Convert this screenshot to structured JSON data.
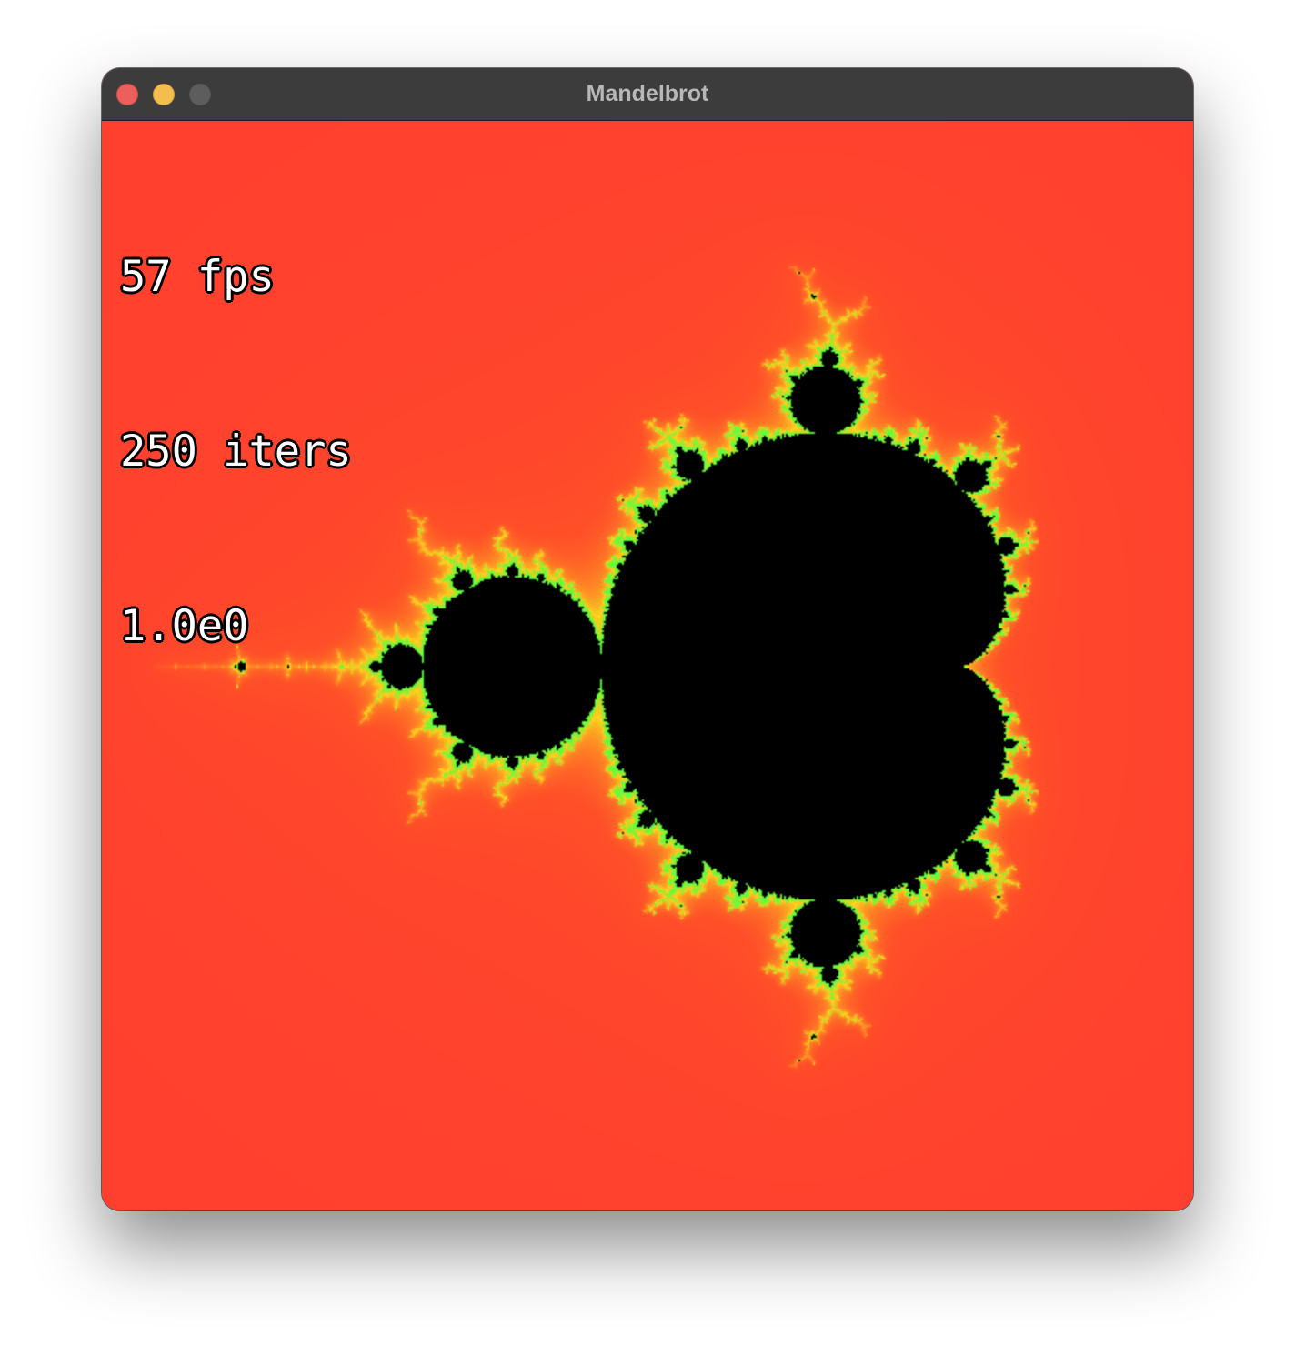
{
  "window": {
    "title": "Mandelbrot"
  },
  "overlay": {
    "fps": "57 fps",
    "iterations": "250 iters",
    "zoom": "1.0e0"
  },
  "colors": {
    "background": "#ff3b30",
    "set_interior": "#000000",
    "edge_glow": "#ffb020",
    "edge_detail": "#5cff3a",
    "titlebar": "#3c3c3c",
    "close": "#ec5f5a",
    "minimize": "#f4bd4f",
    "zoom": "#5d5d5d"
  }
}
